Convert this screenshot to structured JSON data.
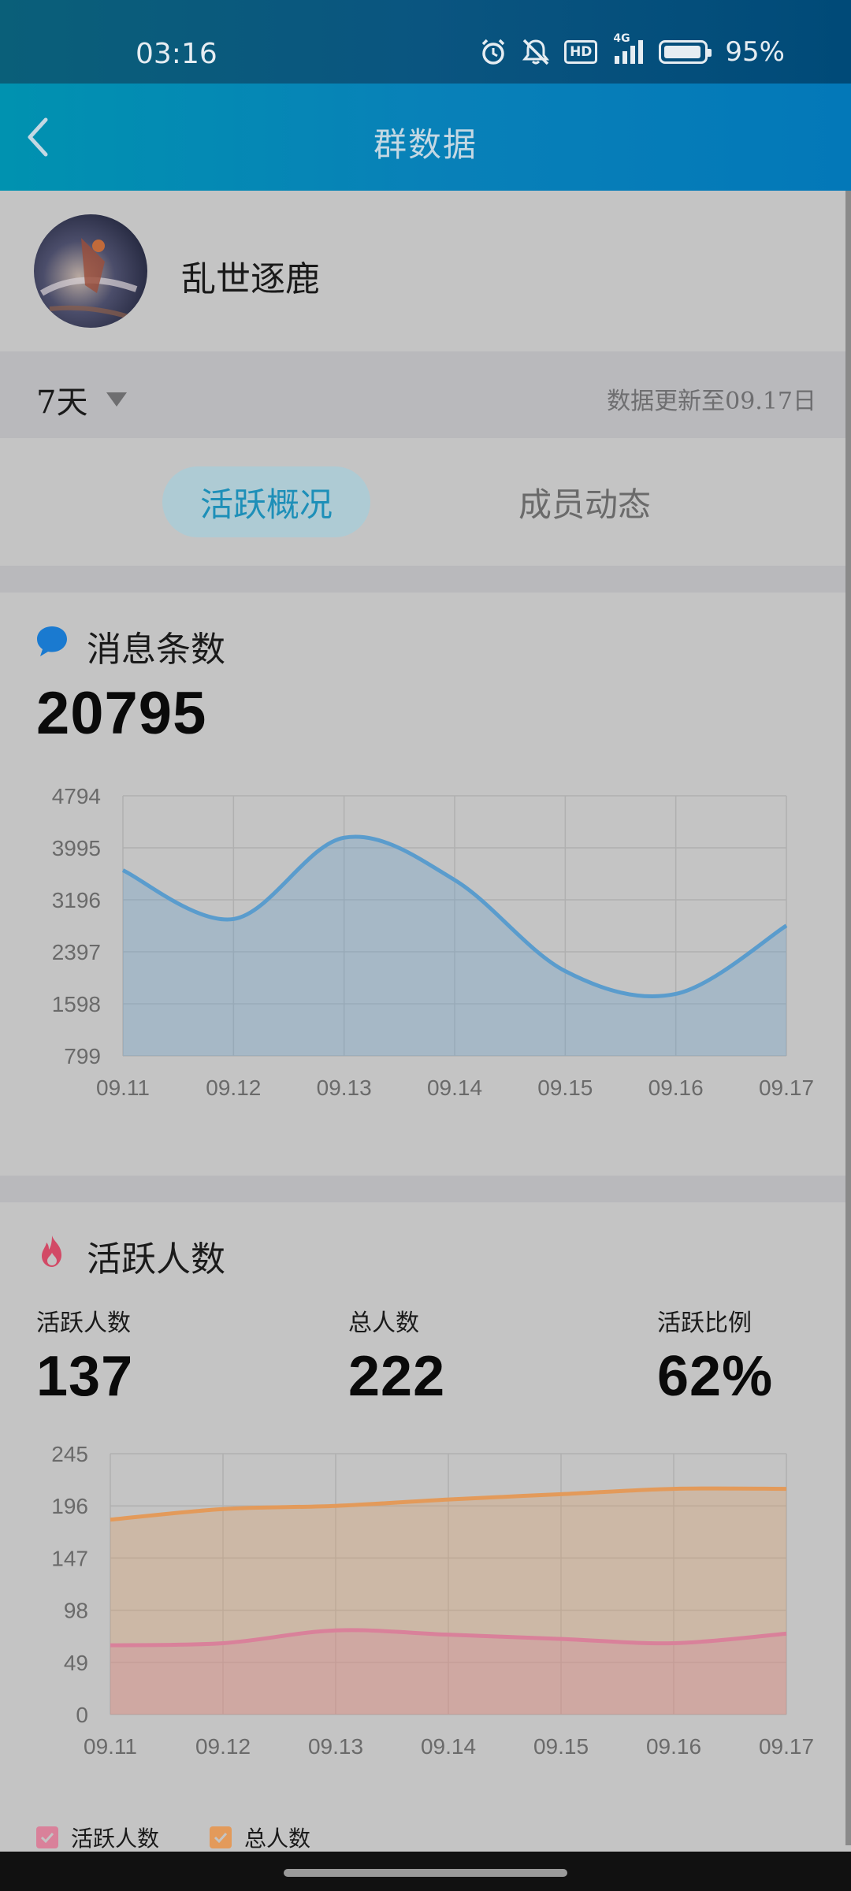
{
  "status_bar": {
    "time": "03:16",
    "battery_text": "95%",
    "network_label": "4G",
    "hd_label": "HD",
    "icons": [
      "alarm-icon",
      "mute-icon",
      "hd-icon",
      "signal-icon",
      "battery-icon"
    ]
  },
  "app_bar": {
    "title": "群数据",
    "back_icon": "chevron-left-icon"
  },
  "group": {
    "name": "乱世逐鹿"
  },
  "filter": {
    "range_value": "7天",
    "update_text": "数据更新至09.17日"
  },
  "tabs": [
    {
      "label": "活跃概况",
      "active": true
    },
    {
      "label": "成员动态",
      "active": false
    }
  ],
  "messages": {
    "title": "消息条数",
    "icon": "chat-bubble-icon",
    "total": "20795"
  },
  "activity": {
    "title": "活跃人数",
    "icon": "flame-icon",
    "stats": [
      {
        "label": "活跃人数",
        "value": "137"
      },
      {
        "label": "总人数",
        "value": "222"
      },
      {
        "label": "活跃比例",
        "value": "62%"
      }
    ]
  },
  "chart_data": [
    {
      "type": "area",
      "x": [
        "09.11",
        "09.12",
        "09.13",
        "09.14",
        "09.15",
        "09.16",
        "09.17"
      ],
      "yticks": [
        "799",
        "1598",
        "2397",
        "3196",
        "3995",
        "4794"
      ],
      "ylim": [
        799,
        4794
      ],
      "series": [
        {
          "values": [
            3650,
            2900,
            4150,
            3500,
            2100,
            1750,
            2800
          ],
          "color": "#5a9ccd"
        }
      ],
      "grid": true
    },
    {
      "type": "area",
      "x": [
        "09.11",
        "09.12",
        "09.13",
        "09.14",
        "09.15",
        "09.16",
        "09.17"
      ],
      "yticks": [
        "0",
        "49",
        "98",
        "147",
        "196",
        "245"
      ],
      "ylim": [
        0,
        245
      ],
      "series": [
        {
          "name": "活跃人数",
          "values": [
            65,
            67,
            79,
            75,
            71,
            67,
            76
          ],
          "color": "#d9819a"
        },
        {
          "name": "总人数",
          "values": [
            183,
            193,
            196,
            202,
            207,
            212,
            212
          ],
          "color": "#e39a5a"
        }
      ],
      "grid": true,
      "legend": "bottom-left"
    }
  ]
}
